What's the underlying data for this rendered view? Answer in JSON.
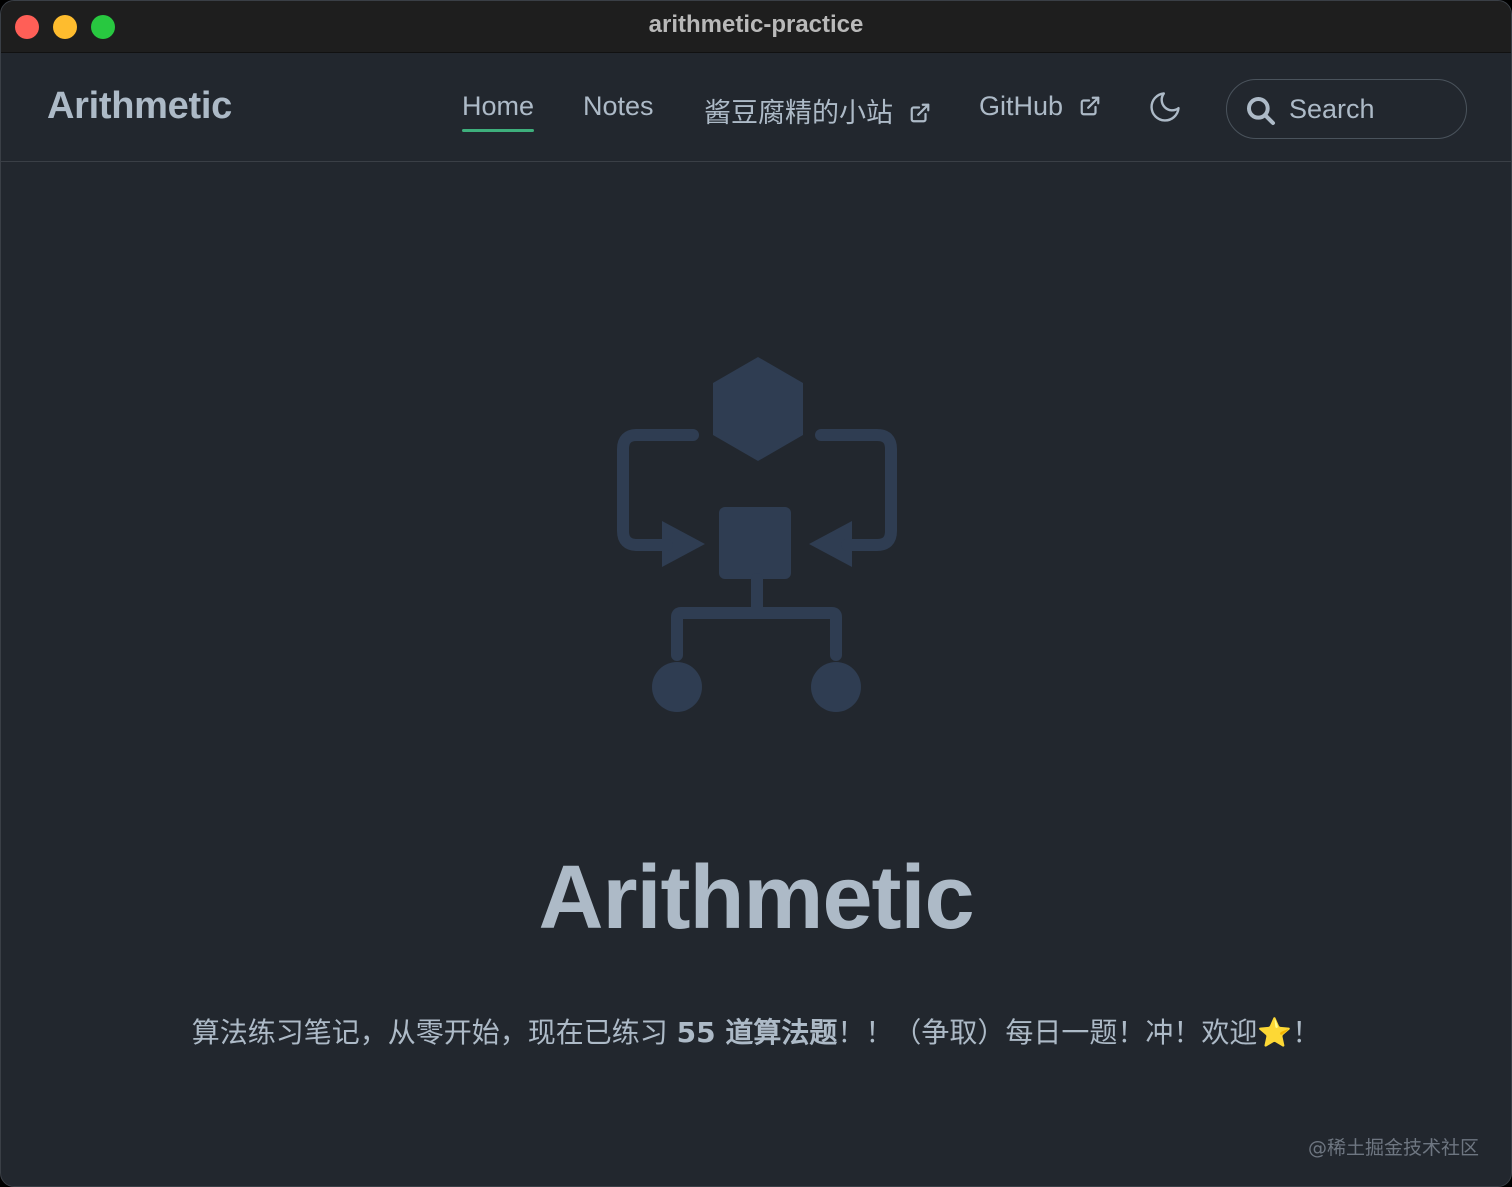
{
  "window": {
    "title": "arithmetic-practice"
  },
  "navbar": {
    "brand": "Arithmetic",
    "links": [
      {
        "label": "Home",
        "active": true
      },
      {
        "label": "Notes"
      },
      {
        "label": "酱豆腐精的小站",
        "external": true
      },
      {
        "label": "GitHub",
        "external": true
      }
    ],
    "theme_toggle_icon": "moon-icon",
    "search": {
      "placeholder": "Search"
    }
  },
  "hero": {
    "image_icon": "algorithm-flowchart-icon",
    "title": "Arithmetic",
    "description_before": "算法练习笔记，从零开始，现在已练习 ",
    "description_bold": "55 道算法题",
    "description_after": "！！（争取）每日一题！冲！欢迎⭐！"
  },
  "watermark": "@稀土掘金技术社区",
  "colors": {
    "background": "#22272e",
    "text": "#adbac7",
    "accent": "#3eaf7c",
    "hero_icon": "#2f3d52"
  }
}
